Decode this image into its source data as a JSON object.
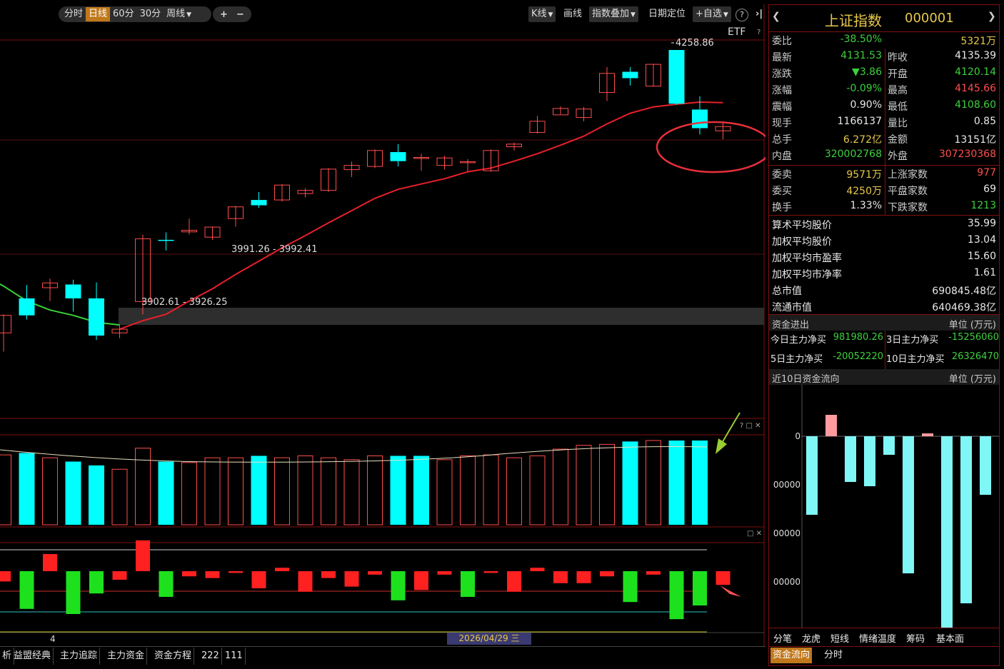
{
  "toolbar": {
    "periods": [
      {
        "label": "分时",
        "active": false
      },
      {
        "label": "日线",
        "active": true
      },
      {
        "label": "60分",
        "active": false
      },
      {
        "label": "30分",
        "active": false
      },
      {
        "label": "周线",
        "active": false
      }
    ],
    "zoom_in": "+",
    "zoom_out": "−",
    "kline": "K线",
    "draw": "画线",
    "overlay": "指数叠加",
    "date_locate": "日期定位",
    "add_watch": "+自选",
    "help": "?",
    "etf": "ETF",
    "etf_help": "?"
  },
  "chart_data": [
    {
      "type": "candlestick",
      "name": "price",
      "up_color": "#ff4d4d",
      "down_color": "#00ffff",
      "candles": [
        {
          "o": 3925,
          "h": 3960,
          "l": 3890,
          "c": 3958
        },
        {
          "o": 3990,
          "h": 4015,
          "l": 3950,
          "c": 3958
        },
        {
          "o": 4010,
          "h": 4027,
          "l": 3985,
          "c": 4019
        },
        {
          "o": 4016,
          "h": 4025,
          "l": 3965,
          "c": 3990
        },
        {
          "o": 3990,
          "h": 4020,
          "l": 3912,
          "c": 3920
        },
        {
          "o": 3925,
          "h": 3940,
          "l": 3915,
          "c": 3932
        },
        {
          "o": 3984,
          "h": 4110,
          "l": 3960,
          "c": 4102
        },
        {
          "o": 4100,
          "h": 4114,
          "l": 4080,
          "c": 4098
        },
        {
          "o": 4115,
          "h": 4140,
          "l": 4110,
          "c": 4118
        },
        {
          "o": 4105,
          "h": 4125,
          "l": 4100,
          "c": 4124
        },
        {
          "o": 4140,
          "h": 4164,
          "l": 4125,
          "c": 4162
        },
        {
          "o": 4175,
          "h": 4190,
          "l": 4160,
          "c": 4165
        },
        {
          "o": 4175,
          "h": 4205,
          "l": 4172,
          "c": 4203
        },
        {
          "o": 4187,
          "h": 4197,
          "l": 4180,
          "c": 4193
        },
        {
          "o": 4193,
          "h": 4235,
          "l": 4190,
          "c": 4233
        },
        {
          "o": 4232,
          "h": 4247,
          "l": 4218,
          "c": 4240
        },
        {
          "o": 4238,
          "h": 4270,
          "l": 4235,
          "c": 4268
        },
        {
          "o": 4265,
          "h": 4280,
          "l": 4238,
          "c": 4248
        },
        {
          "o": 4255,
          "h": 4262,
          "l": 4230,
          "c": 4255
        },
        {
          "o": 4240,
          "h": 4258,
          "l": 4232,
          "c": 4254
        },
        {
          "o": 4246,
          "h": 4252,
          "l": 4228,
          "c": 4247
        },
        {
          "o": 4230,
          "h": 4270,
          "l": 4228,
          "c": 4268
        },
        {
          "o": 4275,
          "h": 4283,
          "l": 4268,
          "c": 4280
        },
        {
          "o": 4302,
          "h": 4333,
          "l": 4300,
          "c": 4323
        },
        {
          "o": 4335,
          "h": 4351,
          "l": 4336,
          "c": 4347
        },
        {
          "o": 4330,
          "h": 4350,
          "l": 4323,
          "c": 4346
        },
        {
          "o": 4377,
          "h": 4425,
          "l": 4361,
          "c": 4413
        },
        {
          "o": 4416,
          "h": 4425,
          "l": 4390,
          "c": 4404
        },
        {
          "o": 4389,
          "h": 4431,
          "l": 4388,
          "c": 4430
        },
        {
          "o": 4457,
          "h": 4457,
          "l": 4354,
          "c": 4356
        },
        {
          "o": 4345,
          "h": 4370,
          "l": 4298,
          "c": 4310
        },
        {
          "o": 4305,
          "h": 4323,
          "l": 4289,
          "c": 4313
        }
      ],
      "ma_red": [
        [
          5,
          3932
        ],
        [
          6,
          3948
        ],
        [
          7,
          3960
        ],
        [
          8,
          3985
        ],
        [
          9,
          4008
        ],
        [
          10,
          4035
        ],
        [
          11,
          4060
        ],
        [
          12,
          4085
        ],
        [
          13,
          4108
        ],
        [
          14,
          4132
        ],
        [
          15,
          4155
        ],
        [
          16,
          4178
        ],
        [
          17,
          4195
        ],
        [
          18,
          4205
        ],
        [
          19,
          4215
        ],
        [
          20,
          4228
        ],
        [
          21,
          4235
        ],
        [
          22,
          4248
        ],
        [
          23,
          4262
        ],
        [
          24,
          4278
        ],
        [
          25,
          4295
        ],
        [
          26,
          4318
        ],
        [
          27,
          4338
        ],
        [
          28,
          4350
        ],
        [
          29,
          4355
        ],
        [
          30,
          4359
        ],
        [
          31,
          4358
        ]
      ],
      "ma_green": [
        [
          -0.5,
          4025
        ],
        [
          0,
          4013
        ],
        [
          1,
          3985
        ],
        [
          2,
          3968
        ],
        [
          3,
          3958
        ],
        [
          4,
          3945
        ],
        [
          5,
          3940
        ]
      ],
      "annotations": [
        {
          "text": "4258.86",
          "at": "top"
        },
        {
          "text": "3991.26 - 3992.41",
          "at": "mid"
        },
        {
          "text": "3902.61 - 3926.25",
          "at": "low"
        }
      ]
    },
    {
      "type": "bar",
      "name": "volume",
      "values": [
        73,
        75,
        70,
        66,
        62,
        58,
        80,
        66,
        65,
        70,
        70,
        72,
        70,
        72,
        70,
        68,
        72,
        72,
        72,
        68,
        72,
        73,
        70,
        72,
        79,
        83,
        84,
        87,
        88,
        88,
        88,
        88,
        88,
        87,
        88,
        79
      ],
      "down": [
        1,
        3,
        4,
        7,
        11,
        17,
        18,
        27,
        29,
        30
      ]
    },
    {
      "type": "bar",
      "name": "capital-flow",
      "values": [
        -6,
        -22,
        10,
        -25,
        -13,
        -5,
        18,
        -15,
        -3,
        -4,
        -1,
        -10,
        2,
        -12,
        -4,
        -9,
        -2,
        -17,
        -11,
        -2,
        -15,
        -1,
        -12,
        2,
        -7,
        -7,
        -3,
        -18,
        -2,
        -28,
        -20,
        -8
      ]
    }
  ],
  "axis_labels": {
    "date": "2026/04/29 三",
    "left_tick": "4"
  },
  "bottom_tabs": [
    "析",
    "益盟经典",
    "主力追踪",
    "主力资金",
    "资金方程",
    "222",
    "111"
  ],
  "quote": {
    "name": "上证指数",
    "code": "000001",
    "rows": [
      {
        "l1": "委比",
        "v1": "-38.50%",
        "c1": "green",
        "l2": "",
        "v2": "5321万",
        "c2": "gold"
      },
      {
        "l1": "最新",
        "v1": "4131.53",
        "c1": "green",
        "l2": "昨收",
        "v2": "4135.39",
        "c2": "white"
      },
      {
        "l1": "涨跌",
        "v1": "▼3.86",
        "c1": "green",
        "l2": "开盘",
        "v2": "4120.14",
        "c2": "green"
      },
      {
        "l1": "涨幅",
        "v1": "-0.09%",
        "c1": "green",
        "l2": "最高",
        "v2": "4145.66",
        "c2": "red"
      },
      {
        "l1": "震幅",
        "v1": "0.90%",
        "c1": "white",
        "l2": "最低",
        "v2": "4108.60",
        "c2": "green"
      },
      {
        "l1": "现手",
        "v1": "1166137",
        "c1": "white",
        "l2": "量比",
        "v2": "0.85",
        "c2": "white"
      },
      {
        "l1": "总手",
        "v1": "6.272亿",
        "c1": "gold",
        "l2": "金额",
        "v2": "13151亿",
        "c2": "white"
      },
      {
        "l1": "内盘",
        "v1": "320002768",
        "c1": "green",
        "l2": "外盘",
        "v2": "307230368",
        "c2": "red"
      }
    ],
    "rows2": [
      {
        "l1": "委卖",
        "v1": "9571万",
        "c1": "gold",
        "l2": "上涨家数",
        "v2": "977",
        "c2": "red"
      },
      {
        "l1": "委买",
        "v1": "4250万",
        "c1": "gold",
        "l2": "平盘家数",
        "v2": "69",
        "c2": "white"
      },
      {
        "l1": "换手",
        "v1": "1.33%",
        "c1": "white",
        "l2": "下跌家数",
        "v2": "1213",
        "c2": "green"
      }
    ],
    "stats": [
      {
        "l": "算术平均股价",
        "v": "35.99"
      },
      {
        "l": "加权平均股价",
        "v": "13.04"
      },
      {
        "l": "加权平均市盈率",
        "v": "15.60"
      },
      {
        "l": "加权平均市净率",
        "v": "1.61"
      },
      {
        "l": "总市值",
        "v": "690845.48亿"
      },
      {
        "l": "流通市值",
        "v": "640469.38亿"
      }
    ]
  },
  "flow": {
    "header": "资金进出",
    "unit": "单位 (万元)",
    "cells": [
      {
        "l": "今日主力净买",
        "v": "981980.26",
        "c": "green"
      },
      {
        "l": "3日主力净买",
        "v": "-15256060",
        "c": "green"
      },
      {
        "l": "5日主力净买",
        "v": "-20052220",
        "c": "green"
      },
      {
        "l": "10日主力净买",
        "v": "26326470",
        "c": "green"
      }
    ]
  },
  "flow10": {
    "header": "近10日资金流向",
    "unit": "单位 (万元)",
    "ticks": [
      "0",
      "00000",
      "00000",
      "00000"
    ],
    "values": [
      -5.5,
      1.5,
      -3.2,
      -3.5,
      -1.3,
      -9.6,
      0.2,
      -16.6,
      -11.7,
      -4.1
    ]
  },
  "side_tabs": [
    "分笔",
    "龙虎",
    "短线",
    "情绪温度",
    "筹码",
    "基本面"
  ],
  "side_tabs2": [
    {
      "label": "资金流向",
      "active": true
    },
    {
      "label": "分时",
      "active": false
    }
  ],
  "panel_icons": {
    "help": "?",
    "restore": "□",
    "close": "✕"
  }
}
